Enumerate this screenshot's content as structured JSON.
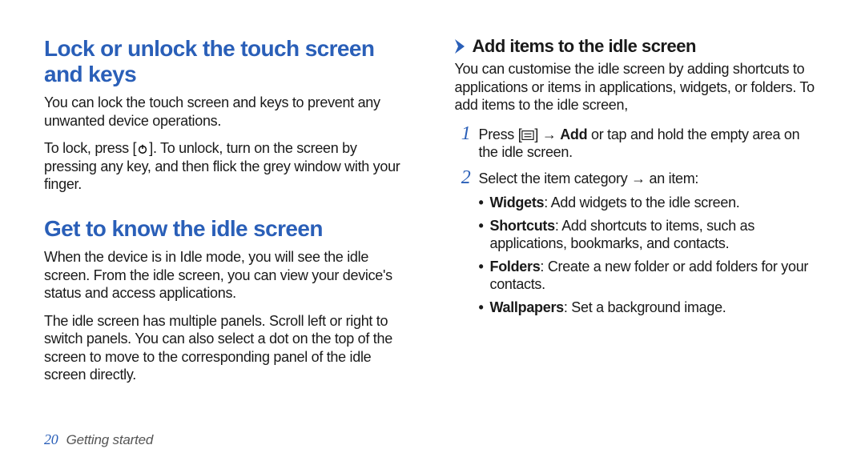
{
  "left": {
    "h1": "Lock or unlock the touch screen and keys",
    "p1": "You can lock the touch screen and keys to prevent any unwanted device operations.",
    "p2a": "To lock, press [",
    "p2b": "]. To unlock, turn on the screen by pressing any key, and then flick the grey window with your finger.",
    "h2": "Get to know the idle screen",
    "p3": "When the device is in Idle mode, you will see the idle screen. From the idle screen, you can view your device's status and access applications.",
    "p4": "The idle screen has multiple panels. Scroll left or right to switch panels. You can also select a dot on the top of the screen to move to the corresponding panel of the idle screen directly."
  },
  "right": {
    "sub": "Add items to the idle screen",
    "p1": "You can customise the idle screen by adding shortcuts to applications or items in applications, widgets, or folders. To add items to the idle screen,",
    "step1a": "Press [",
    "step1b": "] → ",
    "step1bold": "Add",
    "step1c": " or tap and hold the empty area on the idle screen.",
    "step2": "Select the item category → an item:",
    "b1a": "Widgets",
    "b1b": ": Add widgets to the idle screen.",
    "b2a": "Shortcuts",
    "b2b": ": Add shortcuts to items, such as applications, bookmarks, and contacts.",
    "b3a": "Folders",
    "b3b": ": Create a new folder or add folders for your contacts.",
    "b4a": "Wallpapers",
    "b4b": ": Set a background image."
  },
  "footer": {
    "page": "20",
    "title": "Getting started"
  }
}
